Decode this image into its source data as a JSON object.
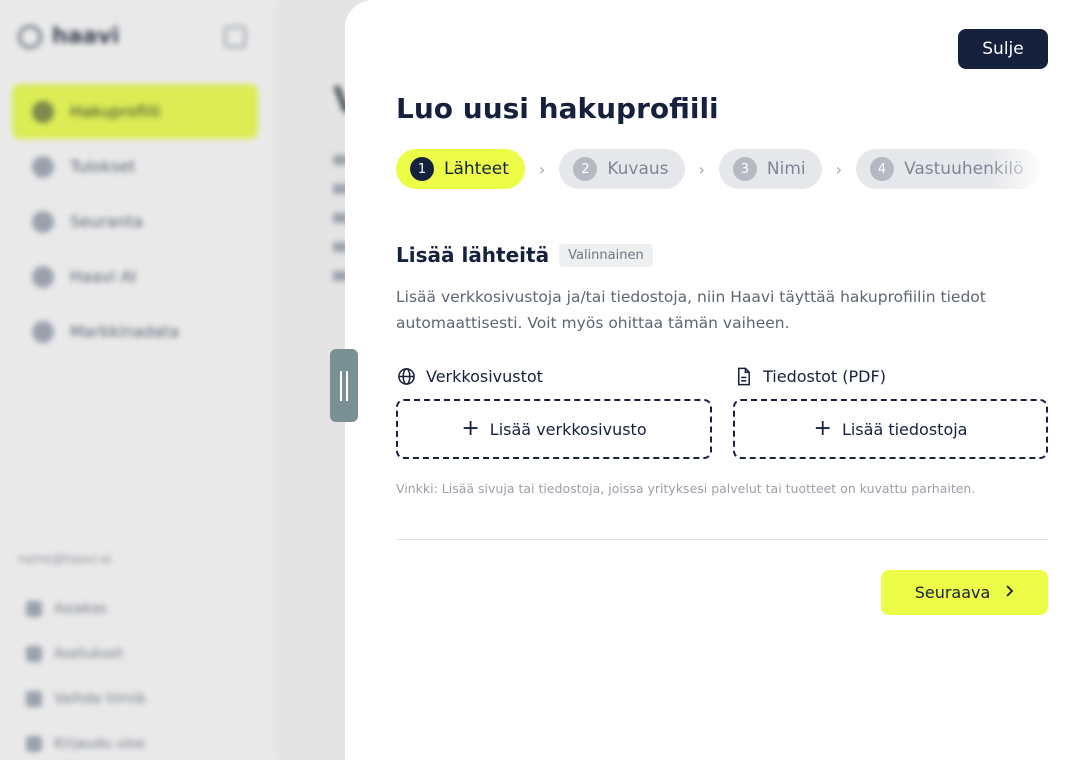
{
  "background": {
    "logo_text": "haavi",
    "nav_items": [
      "Hakuprofiili",
      "Tulokset",
      "Seuranta",
      "Haavi AI",
      "Markkinadata"
    ],
    "email": "name@haavi.ai",
    "footer_items": [
      "Asiakas",
      "Asetukset",
      "Vaihda tiimiä",
      "Kirjaudu ulos"
    ],
    "main_title": "V"
  },
  "panel": {
    "close_label": "Sulje",
    "title": "Luo uusi hakuprofiili",
    "steps": [
      {
        "number": "1",
        "label": "Lähteet",
        "state": "active"
      },
      {
        "number": "2",
        "label": "Kuvaus",
        "state": "inactive"
      },
      {
        "number": "3",
        "label": "Nimi",
        "state": "inactive"
      },
      {
        "number": "4",
        "label": "Vastuuhenkilö",
        "state": "inactive"
      }
    ],
    "section": {
      "title": "Lisää lähteitä",
      "badge": "Valinnainen",
      "description": "Lisää verkkosivustoja ja/tai tiedostoja, niin Haavi täyttää hakuprofiilin tiedot automaattisesti. Voit myös ohittaa tämän vaiheen."
    },
    "websites": {
      "label": "Verkkosivustot",
      "add_label": "Lisää verkkosivusto",
      "icon": "globe-icon"
    },
    "files": {
      "label": "Tiedostot (PDF)",
      "add_label": "Lisää tiedostoja",
      "icon": "document-icon"
    },
    "hint": "Vinkki: Lisää sivuja tai tiedostoja, joissa yrityksesi palvelut tai tuotteet on kuvattu parhaiten.",
    "next_label": "Seuraava"
  },
  "colors": {
    "accent": "#ecfc47",
    "navy": "#16213e",
    "muted": "#5e6573"
  }
}
